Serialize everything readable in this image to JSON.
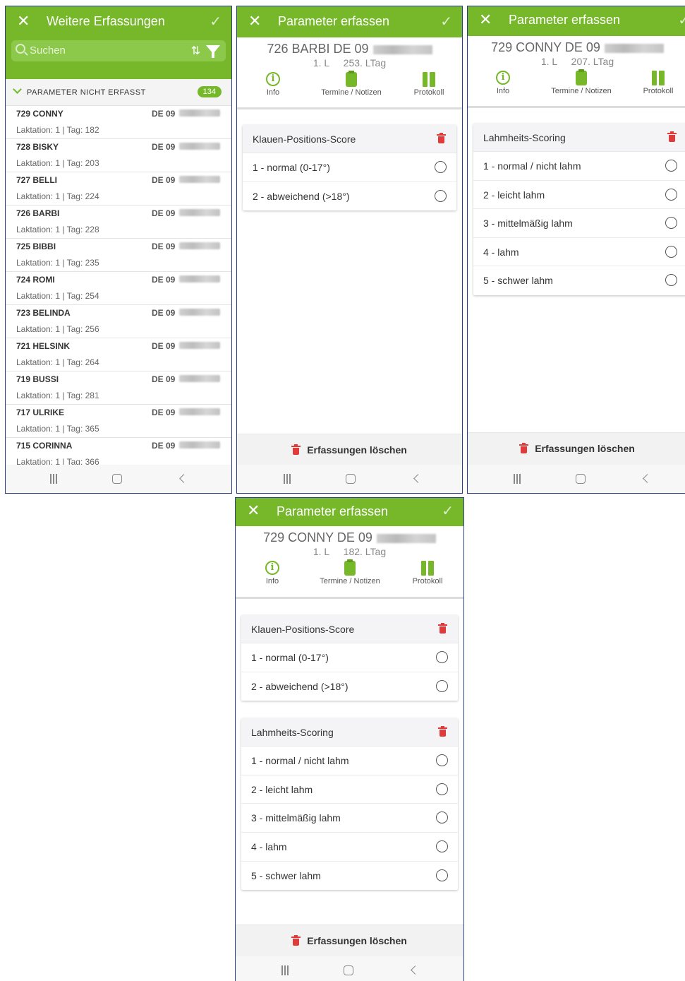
{
  "screen_list": {
    "title": "Weitere Erfassungen",
    "search_placeholder": "Suchen",
    "group_title": "PARAMETER NICHT ERFASST",
    "group_count": "134",
    "items": [
      {
        "name": "729  CONNY",
        "id": "DE 09",
        "meta": "Laktation: 1 | Tag: 182"
      },
      {
        "name": "728  BISKY",
        "id": "DE 09",
        "meta": "Laktation: 1 | Tag: 203"
      },
      {
        "name": "727  BELLI",
        "id": "DE 09",
        "meta": "Laktation: 1 | Tag: 224"
      },
      {
        "name": "726  BARBI",
        "id": "DE 09",
        "meta": "Laktation: 1 | Tag: 228"
      },
      {
        "name": "725  BIBBI",
        "id": "DE 09",
        "meta": "Laktation: 1 | Tag: 235"
      },
      {
        "name": "724  ROMI",
        "id": "DE 09",
        "meta": "Laktation: 1 | Tag: 254"
      },
      {
        "name": "723  BELINDA",
        "id": "DE 09",
        "meta": "Laktation: 1 | Tag: 256"
      },
      {
        "name": "721  HELSINK",
        "id": "DE 09",
        "meta": "Laktation: 1 | Tag: 264"
      },
      {
        "name": "719  BUSSI",
        "id": "DE 09",
        "meta": "Laktation: 1 | Tag: 281"
      },
      {
        "name": "717  ULRIKE",
        "id": "DE 09",
        "meta": "Laktation: 1 | Tag: 365"
      },
      {
        "name": "715  CORINNA",
        "id": "DE 09",
        "meta": "Laktation: 1 | Tag: 366"
      }
    ]
  },
  "header_title": "Parameter erfassen",
  "tabs": {
    "info": "Info",
    "termine": "Termine / Notizen",
    "protokoll": "Protokoll"
  },
  "footer_delete": "Erfassungen löschen",
  "klauen": {
    "title": "Klauen-Positions-Score",
    "options": [
      "1 - normal (0-17°)",
      "2 - abweichend (>18°)"
    ]
  },
  "lahm": {
    "title": "Lahmheits-Scoring",
    "options": [
      "1 - normal / nicht lahm",
      "2 - leicht lahm",
      "3 - mittelmäßig lahm",
      "4 - lahm",
      "5 - schwer lahm"
    ]
  },
  "screen2": {
    "animal": "726 BARBI DE 09",
    "lact": "1. L",
    "ltag": "253. LTag"
  },
  "screen3": {
    "animal": "729 CONNY DE 09",
    "lact": "1. L",
    "ltag": "207. LTag"
  },
  "screen4": {
    "animal": "729 CONNY DE 09",
    "lact": "1. L",
    "ltag": "182. LTag"
  },
  "colors": {
    "accent": "#76b82a",
    "delete": "#e03a3a"
  }
}
